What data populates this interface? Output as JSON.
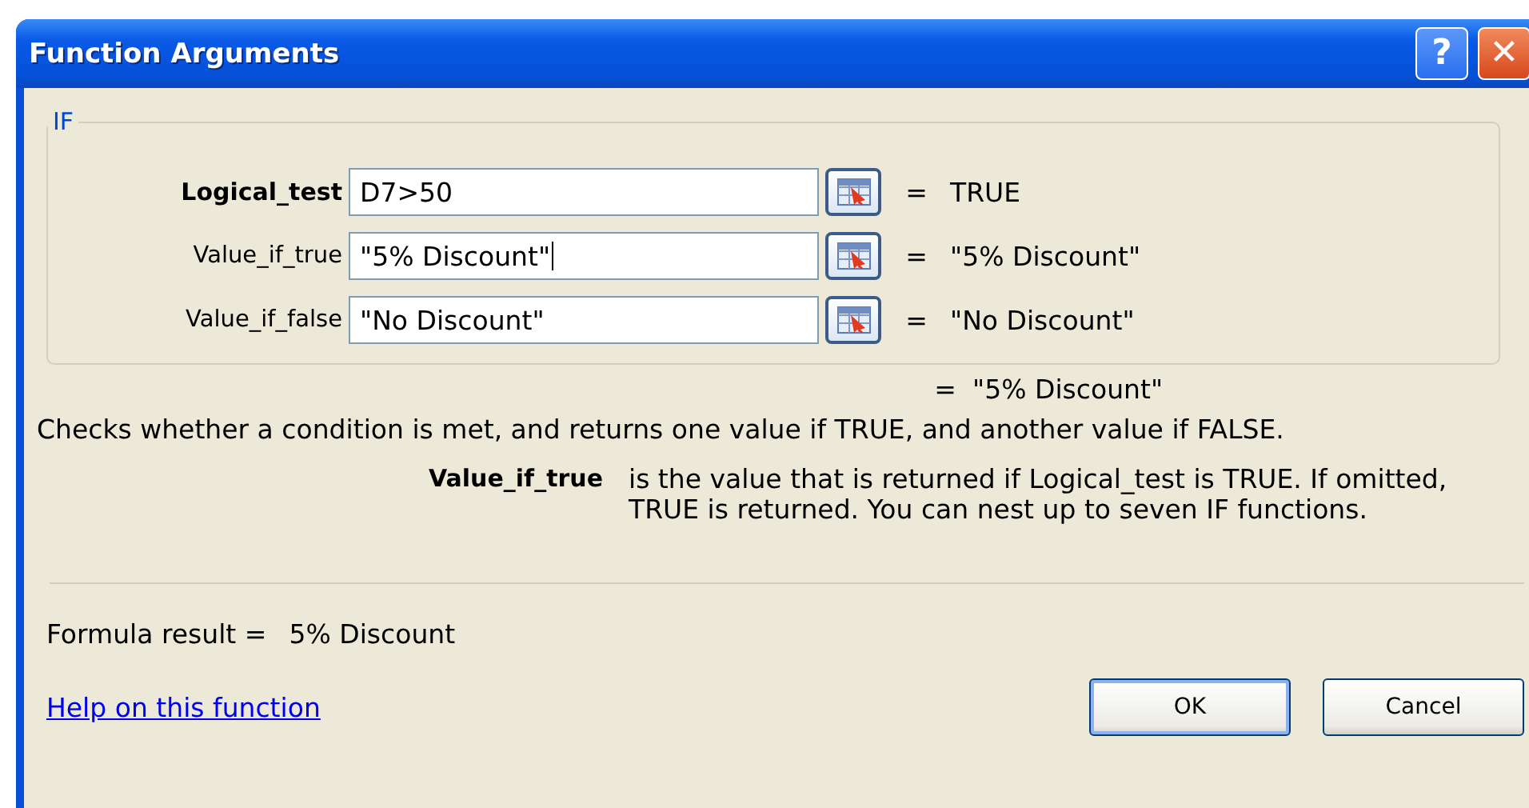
{
  "window": {
    "title": "Function Arguments"
  },
  "title_buttons": [
    {
      "kind": "help",
      "label": "?"
    },
    {
      "kind": "close",
      "label": "✕"
    }
  ],
  "group": {
    "title": "IF"
  },
  "arguments": [
    {
      "label": "Logical_test",
      "bold": true,
      "value": "D7>50",
      "focused": false,
      "result": "TRUE"
    },
    {
      "label": "Value_if_true",
      "bold": false,
      "value": "\"5% Discount\"",
      "focused": true,
      "result": "\"5% Discount\""
    },
    {
      "label": "Value_if_false",
      "bold": false,
      "value": "\"No Discount\"",
      "focused": false,
      "result": "\"No Discount\""
    }
  ],
  "equals_sign": "=",
  "function_result": "\"5% Discount\"",
  "description": "Checks whether a condition is met, and returns one value if TRUE, and another value if FALSE.",
  "argument_help": {
    "name": "Value_if_true",
    "text": "is the value that is returned if Logical_test is TRUE. If omitted, TRUE is returned. You can nest up to seven IF functions."
  },
  "formula_result": {
    "label": "Formula result =",
    "value": "5% Discount"
  },
  "help_link": "Help on this function",
  "buttons": [
    "OK",
    "Cancel"
  ]
}
